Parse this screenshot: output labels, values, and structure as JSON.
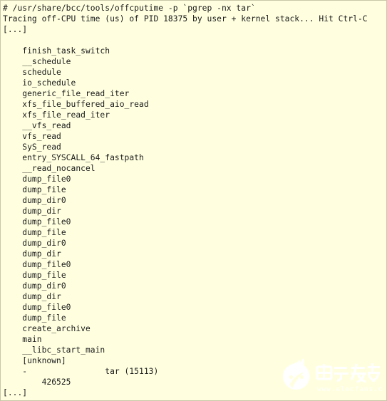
{
  "terminal": {
    "background_color": "#FFFFE0",
    "text_color": "#1A1A1A",
    "border_color": "#C8C8A8",
    "lines": [
      "# /usr/share/bcc/tools/offcputime -p `pgrep -nx tar`",
      "Tracing off-CPU time (us) of PID 18375 by user + kernel stack... Hit Ctrl-C",
      "[...]",
      "",
      "    finish_task_switch",
      "    __schedule",
      "    schedule",
      "    io_schedule",
      "    generic_file_read_iter",
      "    xfs_file_buffered_aio_read",
      "    xfs_file_read_iter",
      "    __vfs_read",
      "    vfs_read",
      "    SyS_read",
      "    entry_SYSCALL_64_fastpath",
      "    __read_nocancel",
      "    dump_file0",
      "    dump_file",
      "    dump_dir0",
      "    dump_dir",
      "    dump_file0",
      "    dump_file",
      "    dump_dir0",
      "    dump_dir",
      "    dump_file0",
      "    dump_file",
      "    dump_dir0",
      "    dump_dir",
      "    dump_file0",
      "    dump_file",
      "    create_archive",
      "    main",
      "    __libc_start_main",
      "    [unknown]",
      "    -                tar (15113)",
      "        426525",
      "[...]"
    ],
    "command": {
      "prompt": "#",
      "tool_path": "/usr/share/bcc/tools/offcputime",
      "flag_pid": "-p",
      "pid_expression": "`pgrep -nx tar`"
    },
    "status_message": {
      "text": "Tracing off-CPU time (us) of PID 18375 by user + kernel stack... Hit Ctrl-C",
      "metric_unit": "us",
      "pid": "18375",
      "stack_type": "user + kernel stack",
      "interrupt_hint": "Hit Ctrl-C"
    },
    "truncation_marker": "[...]",
    "stack_summary": {
      "process_name": "tar",
      "process_pid": "15113",
      "process_line": "-                tar (15113)",
      "total_time_us": "426525"
    }
  },
  "watermark": {
    "brand_cn": "电子发烧友",
    "brand_url": "www.elecfans.com",
    "color": "#FFFFFF"
  }
}
